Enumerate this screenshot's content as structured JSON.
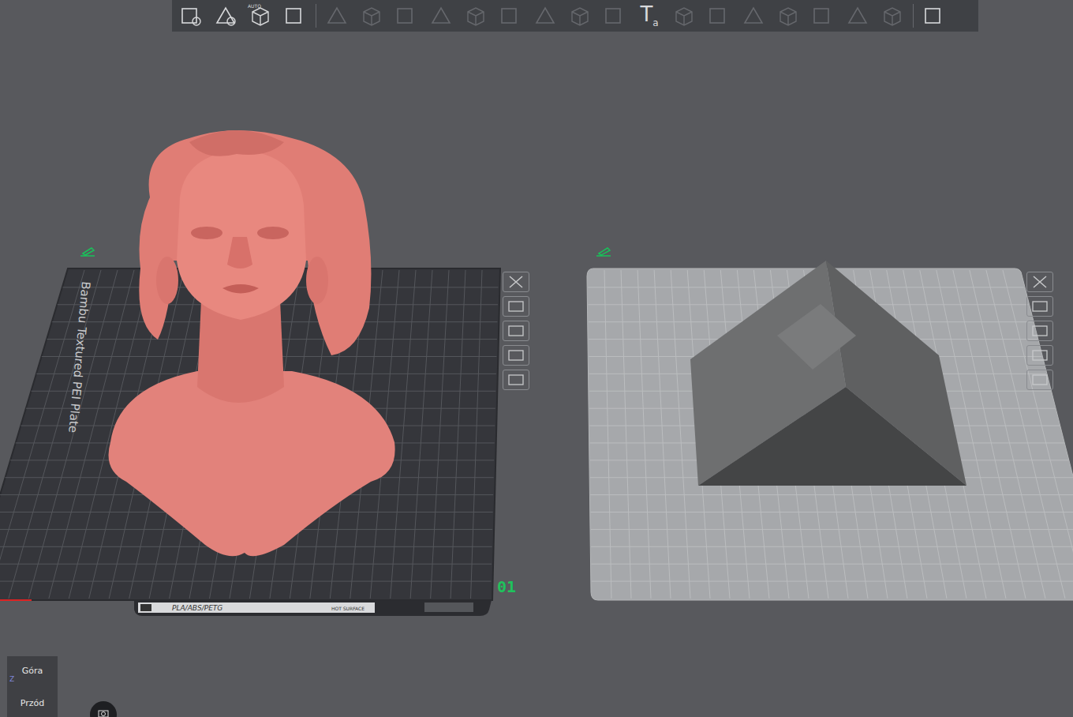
{
  "toolbar": {
    "items": [
      {
        "disabled": false,
        "label": ""
      },
      {
        "disabled": false,
        "label": ""
      },
      {
        "disabled": false,
        "label": "AUTO"
      },
      {
        "disabled": false,
        "label": ""
      },
      {
        "disabled": true,
        "label": ""
      },
      {
        "disabled": true,
        "label": ""
      },
      {
        "disabled": true,
        "label": ""
      },
      {
        "disabled": true,
        "label": ""
      },
      {
        "disabled": true,
        "label": ""
      },
      {
        "disabled": true,
        "label": ""
      },
      {
        "disabled": true,
        "label": ""
      },
      {
        "disabled": true,
        "label": ""
      },
      {
        "disabled": true,
        "label": ""
      },
      {
        "disabled": false,
        "label": "T",
        "sub": "a"
      },
      {
        "disabled": true,
        "label": ""
      },
      {
        "disabled": true,
        "label": ""
      },
      {
        "disabled": true,
        "label": ""
      },
      {
        "disabled": true,
        "label": ""
      },
      {
        "disabled": true,
        "label": ""
      },
      {
        "disabled": true,
        "label": ""
      },
      {
        "disabled": true,
        "label": ""
      },
      {
        "disabled": false,
        "label": ""
      }
    ]
  },
  "plates": [
    {
      "kind": "textured",
      "selected": true,
      "bed_name": "Bambu Textured PEI Plate",
      "number": "01",
      "filaments": "PLA/ABS/PETG",
      "warning": "HOT SURFACE",
      "object": "bust"
    },
    {
      "kind": "plain",
      "selected": false,
      "object": "prism"
    }
  ],
  "view_cube": {
    "top": "Góra",
    "front": "Przód",
    "axis": "Z"
  }
}
